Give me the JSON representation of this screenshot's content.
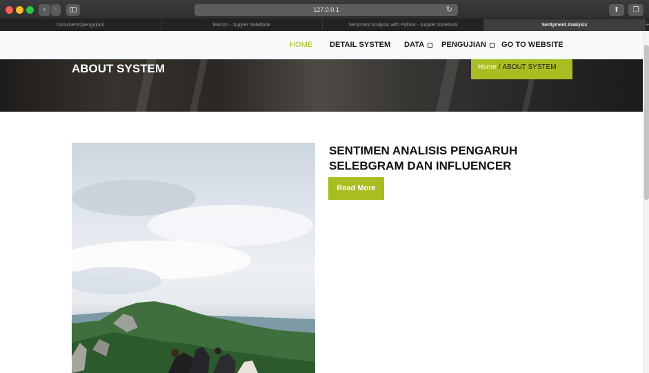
{
  "browser": {
    "url": "127.0.0.1",
    "tabs": [
      {
        "label": "Documents/pengujian/",
        "active": false
      },
      {
        "label": "lexicon - Jupyter Notebook",
        "active": false
      },
      {
        "label": "Sentiment Analysis with Python - Jupyter Notebook",
        "active": false
      },
      {
        "label": "Sentyment Analysis",
        "active": true
      }
    ],
    "new_tab_symbol": "+",
    "icons": {
      "back": "chevron-left-icon",
      "forward": "chevron-right-icon",
      "sidebar": "sidebar-icon",
      "reload": "reload-icon",
      "share": "share-icon",
      "tabs": "tabs-overview-icon"
    }
  },
  "nav": {
    "items": [
      {
        "label": "HOME",
        "active": true,
        "dropdown": false
      },
      {
        "label": "DETAIL SYSTEM",
        "active": false,
        "dropdown": false
      },
      {
        "label": "DATA",
        "active": false,
        "dropdown": true
      },
      {
        "label": "PENGUJIAN",
        "active": false,
        "dropdown": true
      },
      {
        "label": "GO TO WEBSITE",
        "active": false,
        "dropdown": false
      }
    ]
  },
  "hero": {
    "title": "ABOUT SYSTEM",
    "breadcrumb": {
      "home": "Home",
      "separator": "/",
      "current": "ABOUT SYSTEM"
    }
  },
  "main": {
    "article_title": "SENTIMEN ANALISIS PENGARUH SELEBGRAM DAN INFLUENCER",
    "read_more_label": "Read More"
  },
  "colors": {
    "accent": "#a9bd22",
    "text_dark": "#111111",
    "nav_bg": "#f8f9fa"
  }
}
